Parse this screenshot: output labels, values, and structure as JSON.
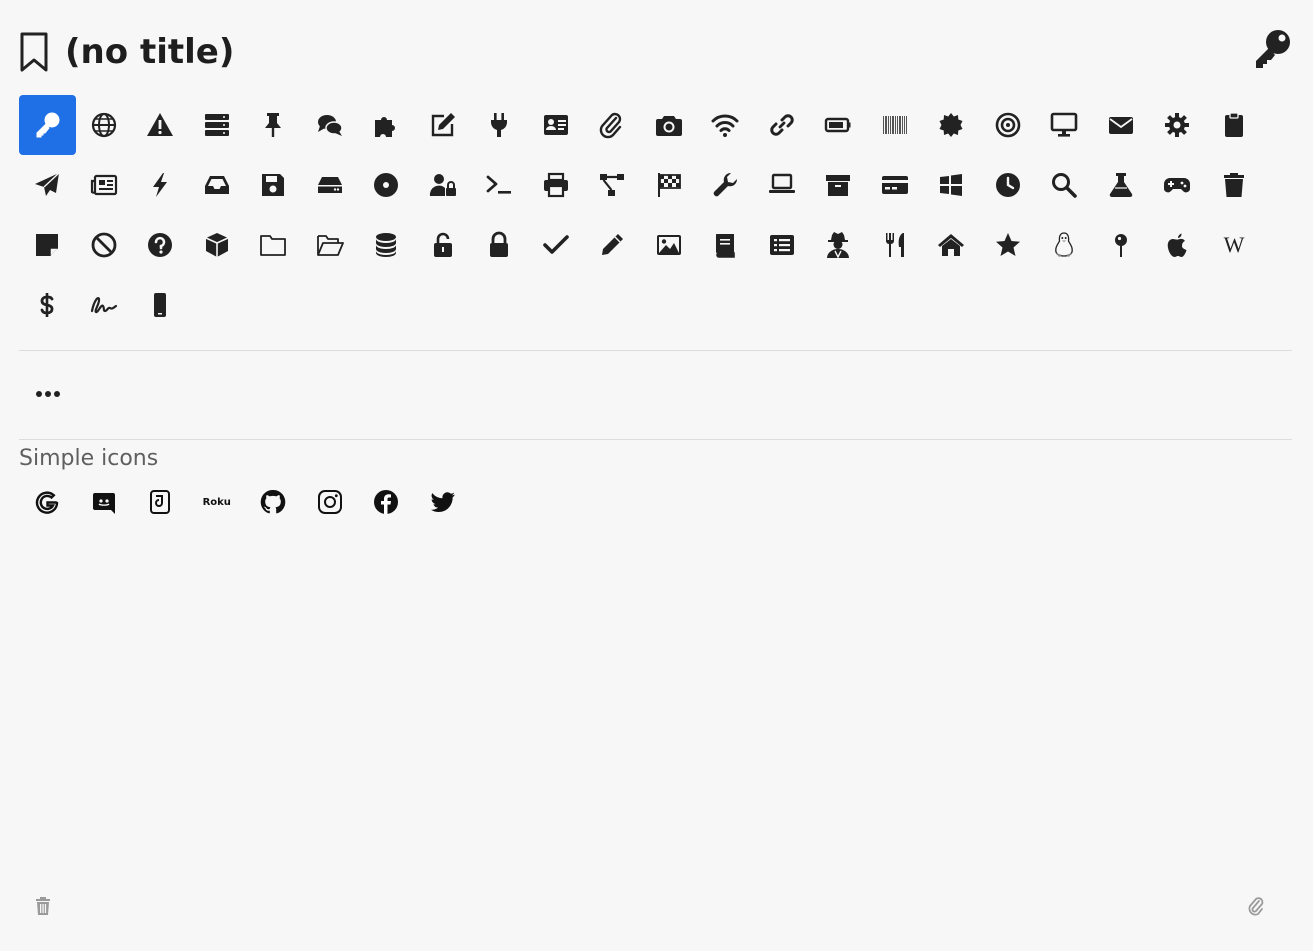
{
  "header": {
    "title": "(no title)"
  },
  "icons": [
    "key-icon",
    "globe-icon",
    "warning-icon",
    "server-icon",
    "pin-icon",
    "comments-icon",
    "puzzle-icon",
    "edit-icon",
    "plug-icon",
    "id-card-icon",
    "paperclip-icon",
    "camera-icon",
    "wifi-icon",
    "link-icon",
    "battery-icon",
    "barcode-icon",
    "badge-icon",
    "target-icon",
    "monitor-icon",
    "envelope-icon",
    "gear-icon",
    "clipboard-icon",
    "paper-plane-icon",
    "newspaper-icon",
    "bolt-icon",
    "inbox-icon",
    "floppy-icon",
    "hdd-icon",
    "disc-icon",
    "user-lock-icon",
    "terminal-icon",
    "printer-icon",
    "network-icon",
    "checkered-flag-icon",
    "wrench-icon",
    "laptop-icon",
    "archive-icon",
    "credit-card-icon",
    "windows-icon",
    "clock-icon",
    "search-icon",
    "flask-icon",
    "gamepad-icon",
    "trash-icon",
    "sticky-note-icon",
    "ban-icon",
    "question-icon",
    "cube-icon",
    "folder-icon",
    "folder-open-icon",
    "database-icon",
    "unlock-icon",
    "lock-icon",
    "check-icon",
    "pencil-icon",
    "image-icon",
    "book-icon",
    "list-icon",
    "user-secret-icon",
    "utensils-icon",
    "home-icon",
    "star-icon",
    "linux-icon",
    "map-pin-icon",
    "apple-icon",
    "wikipedia-icon",
    "dollar-icon",
    "signature-icon",
    "mobile-icon"
  ],
  "selected_index": 0,
  "more_icon": "ellipsis-icon",
  "simple_icons": {
    "title": "Simple icons",
    "items": [
      "google-icon",
      "discord-icon",
      "signal-icon",
      "roku-icon",
      "github-icon",
      "instagram-icon",
      "facebook-icon",
      "twitter-icon"
    ],
    "roku_label": "Roku"
  },
  "footer": {
    "left_icon": "trash-icon",
    "right_icon": "paperclip-icon"
  },
  "colors": {
    "accent": "#1f6fe6",
    "icon": "#222222",
    "footer_icon": "#9a9a9a"
  }
}
